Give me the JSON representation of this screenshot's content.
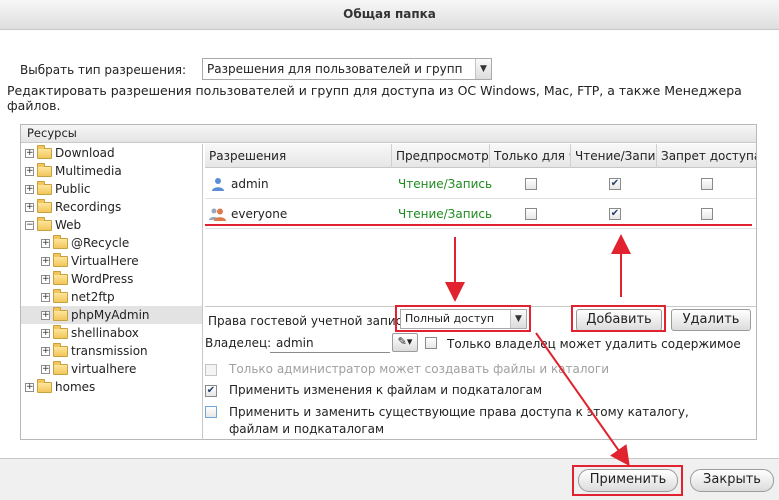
{
  "window": {
    "title": "Общая папка"
  },
  "permission_type": {
    "label": "Выбрать тип разрешения:",
    "selected": "Разрешения для пользователей и групп"
  },
  "description": "Редактировать разрешения пользователей и групп для доступа из ОС Windows, Mac, FTP, а также Менеджера файлов.",
  "resources": {
    "header": "Ресурсы",
    "tree": [
      {
        "label": "Download",
        "level": 0,
        "expander": "+"
      },
      {
        "label": "Multimedia",
        "level": 0,
        "expander": "+"
      },
      {
        "label": "Public",
        "level": 0,
        "expander": "+"
      },
      {
        "label": "Recordings",
        "level": 0,
        "expander": "+"
      },
      {
        "label": "Web",
        "level": 0,
        "expander": "−"
      },
      {
        "label": "@Recycle",
        "level": 1,
        "expander": "+"
      },
      {
        "label": "VirtualHere",
        "level": 1,
        "expander": "+"
      },
      {
        "label": "WordPress",
        "level": 1,
        "expander": "+"
      },
      {
        "label": "net2ftp",
        "level": 1,
        "expander": "+"
      },
      {
        "label": "phpMyAdmin",
        "level": 1,
        "expander": "+",
        "selected": true
      },
      {
        "label": "shellinabox",
        "level": 1,
        "expander": "+"
      },
      {
        "label": "transmission",
        "level": 1,
        "expander": "+"
      },
      {
        "label": "virtualhere",
        "level": 1,
        "expander": "+"
      },
      {
        "label": "homes",
        "level": 0,
        "expander": "+"
      }
    ]
  },
  "permissions": {
    "columns": [
      "Разрешения",
      "Предпросмотр",
      "Только для чтения",
      "Чтение/Запись",
      "Запрет доступа"
    ],
    "rows": [
      {
        "name": "admin",
        "icon": "user-icon",
        "preview": "Чтение/Запись",
        "read_only": false,
        "read_write": true,
        "deny": false
      },
      {
        "name": "everyone",
        "icon": "group-icon",
        "preview": "Чтение/Запись",
        "read_only": false,
        "read_write": true,
        "deny": false
      }
    ]
  },
  "guest": {
    "label": "Права гостевой учетной записи",
    "selected": "Полный доступ"
  },
  "buttons": {
    "add": "Добавить",
    "remove": "Удалить",
    "apply": "Применить",
    "close": "Закрыть"
  },
  "owner": {
    "label": "Владелец:",
    "value": "admin",
    "only_owner_delete": "Только владелец может удалить содержимое",
    "only_owner_delete_checked": false
  },
  "options": {
    "admin_only_create": {
      "label": "Только администратор может создавать файлы и каталоги",
      "checked": false,
      "disabled": true
    },
    "apply_to_subfolders": {
      "label": "Применить изменения к файлам и подкаталогам",
      "checked": true
    },
    "apply_replace": {
      "label": "Применить и заменить существующие права доступа к этому каталогу, файлам и подкаталогам",
      "checked": false
    }
  },
  "colors": {
    "annotation_red": "#e0232e",
    "preview_green": "#1e8b1e"
  }
}
